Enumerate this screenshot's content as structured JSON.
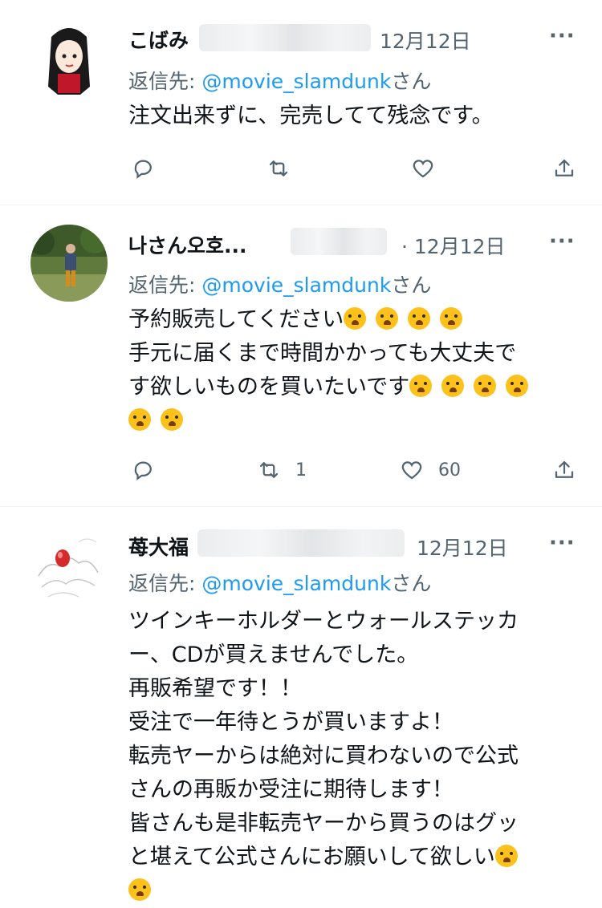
{
  "tweets": [
    {
      "name": "こばみ",
      "date": "12月12日",
      "reply_prefix": "返信先: ",
      "mention": "@movie_slamdunk",
      "reply_suffix": "さん",
      "lines": [
        "注文出来ずに、完売してて残念です。"
      ],
      "retweets": "",
      "likes": ""
    },
    {
      "name": "나さん오호...",
      "date": "· 12月12日",
      "reply_prefix": "返信先: ",
      "mention": "@movie_slamdunk",
      "reply_suffix": "さん",
      "lines": [
        "予約販売してください",
        "手元に届くまで時間かかっても大丈夫で",
        "す欲しいものを買いたいです",
        ""
      ],
      "retweets": "1",
      "likes": "60"
    },
    {
      "name": "苺大福",
      "date": "12月12日",
      "reply_prefix": "返信先: ",
      "mention": "@movie_slamdunk",
      "reply_suffix": "さん",
      "lines": [
        "ツインキーホルダーとウォールステッカ",
        "ー、CDが買えませんでした。",
        "再販希望です！！",
        "受注で一年待とうが買いますよ！",
        "転売ヤーからは絶対に買わないので公式",
        "さんの再販か受注に期待します！",
        "皆さんも是非転売ヤーから買うのはグッ",
        "と堪えて公式さんにお願いして欲しい",
        ""
      ],
      "retweets": "",
      "likes": ""
    }
  ],
  "icons": {
    "reply": "speech-bubble-icon",
    "retweet": "retweet-icon",
    "like": "heart-icon",
    "share": "share-upload-icon",
    "more": "more-dots-icon",
    "emoji": "loudly-crying-face-emoji"
  },
  "ui": {
    "more_glyph": "···"
  },
  "colors": {
    "text": "#0f1419",
    "muted": "#536471",
    "link": "#1d9bf0",
    "divider": "#eff3f4"
  }
}
